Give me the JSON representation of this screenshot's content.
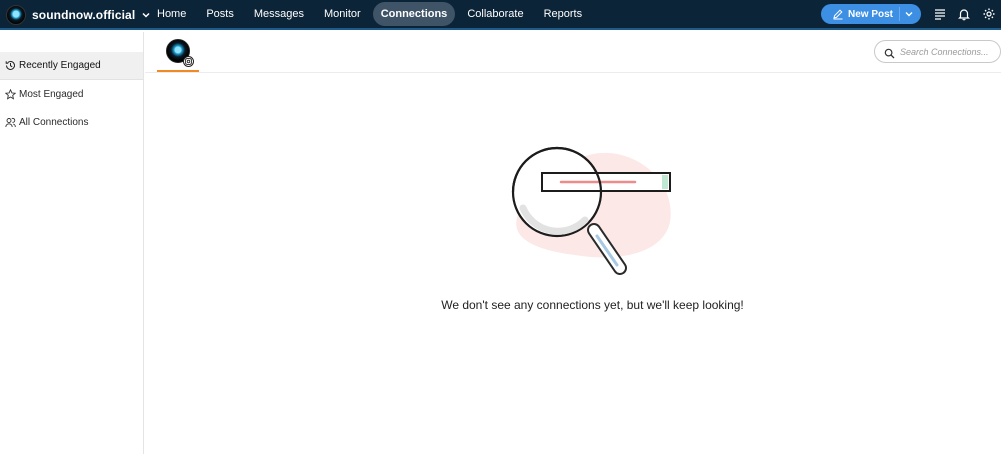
{
  "topbar": {
    "account_name": "soundnow.official",
    "nav": [
      {
        "label": "Home",
        "active": false
      },
      {
        "label": "Posts",
        "active": false
      },
      {
        "label": "Messages",
        "active": false
      },
      {
        "label": "Monitor",
        "active": false
      },
      {
        "label": "Connections",
        "active": true
      },
      {
        "label": "Collaborate",
        "active": false
      },
      {
        "label": "Reports",
        "active": false
      }
    ],
    "new_post_label": "New Post",
    "icons": [
      "menu-icon",
      "bell-icon",
      "gear-icon"
    ]
  },
  "sidebar": {
    "items": [
      {
        "label": "Recently Engaged",
        "icon": "clock-history-icon",
        "active": true
      },
      {
        "label": "Most Engaged",
        "icon": "star-icon",
        "active": false
      },
      {
        "label": "All Connections",
        "icon": "people-icon",
        "active": false
      }
    ]
  },
  "search": {
    "placeholder": "Search Connections..."
  },
  "empty_state": {
    "message": "We don't see any connections yet, but we'll keep looking!"
  },
  "colors": {
    "topbar_bg": "#0c2438",
    "active_nav_bg": "#3f5466",
    "new_post_bg": "#3d8fe4",
    "tab_underline": "#f08a24",
    "illustration_blob": "#fde8e8"
  }
}
